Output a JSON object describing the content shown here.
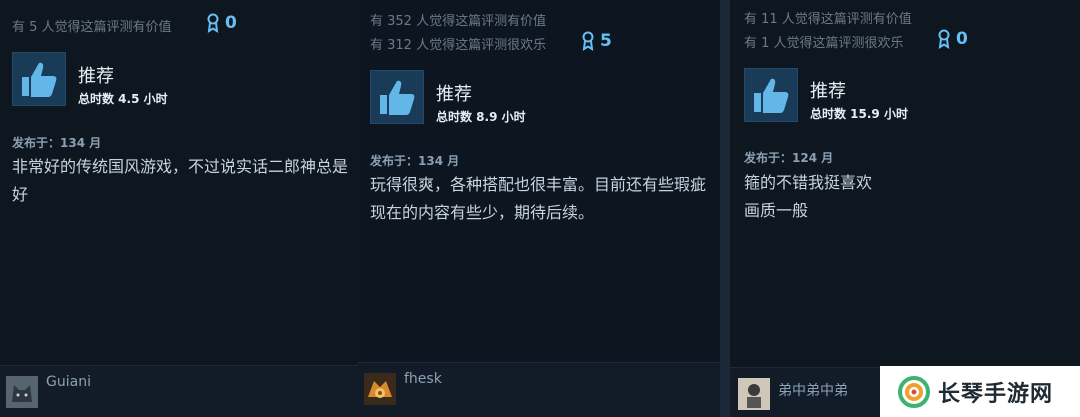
{
  "reviews": [
    {
      "helpful_lines": [
        "有 5 人觉得这篇评测有价值"
      ],
      "award_count": "0",
      "recommend_label": "推荐",
      "hours": "总时数 4.5 小时",
      "posted": "发布于：134 月",
      "text_lines": [
        "非常好的传统国风游戏，不过说实话二郎神总是",
        "好"
      ],
      "username": "Guiani"
    },
    {
      "helpful_lines": [
        "有 352 人觉得这篇评测有价值",
        "有 312 人觉得这篇评测很欢乐"
      ],
      "award_count": "5",
      "recommend_label": "推荐",
      "hours": "总时数 8.9 小时",
      "posted": "发布于：134 月",
      "text_lines": [
        "玩得很爽，各种搭配也很丰富。目前还有些瑕疵",
        "现在的内容有些少，期待后续。"
      ],
      "username": "fhesk"
    },
    {
      "helpful_lines": [
        "有 11 人觉得这篇评测有价值",
        "有 1 人觉得这篇评测很欢乐"
      ],
      "award_count": "0",
      "recommend_label": "推荐",
      "hours": "总时数 15.9 小时",
      "posted": "发布于：124 月",
      "text_lines": [
        "箍的不错我挺喜欢",
        "画质一般"
      ],
      "username": "弟中弟中弟"
    }
  ],
  "icons": {
    "thumb": "thumbs-up-icon",
    "award": "award-ribbon-icon"
  },
  "colors": {
    "accent": "#66c0f4",
    "background": "#0e1620"
  },
  "watermark": {
    "text": "长琴手游网"
  }
}
